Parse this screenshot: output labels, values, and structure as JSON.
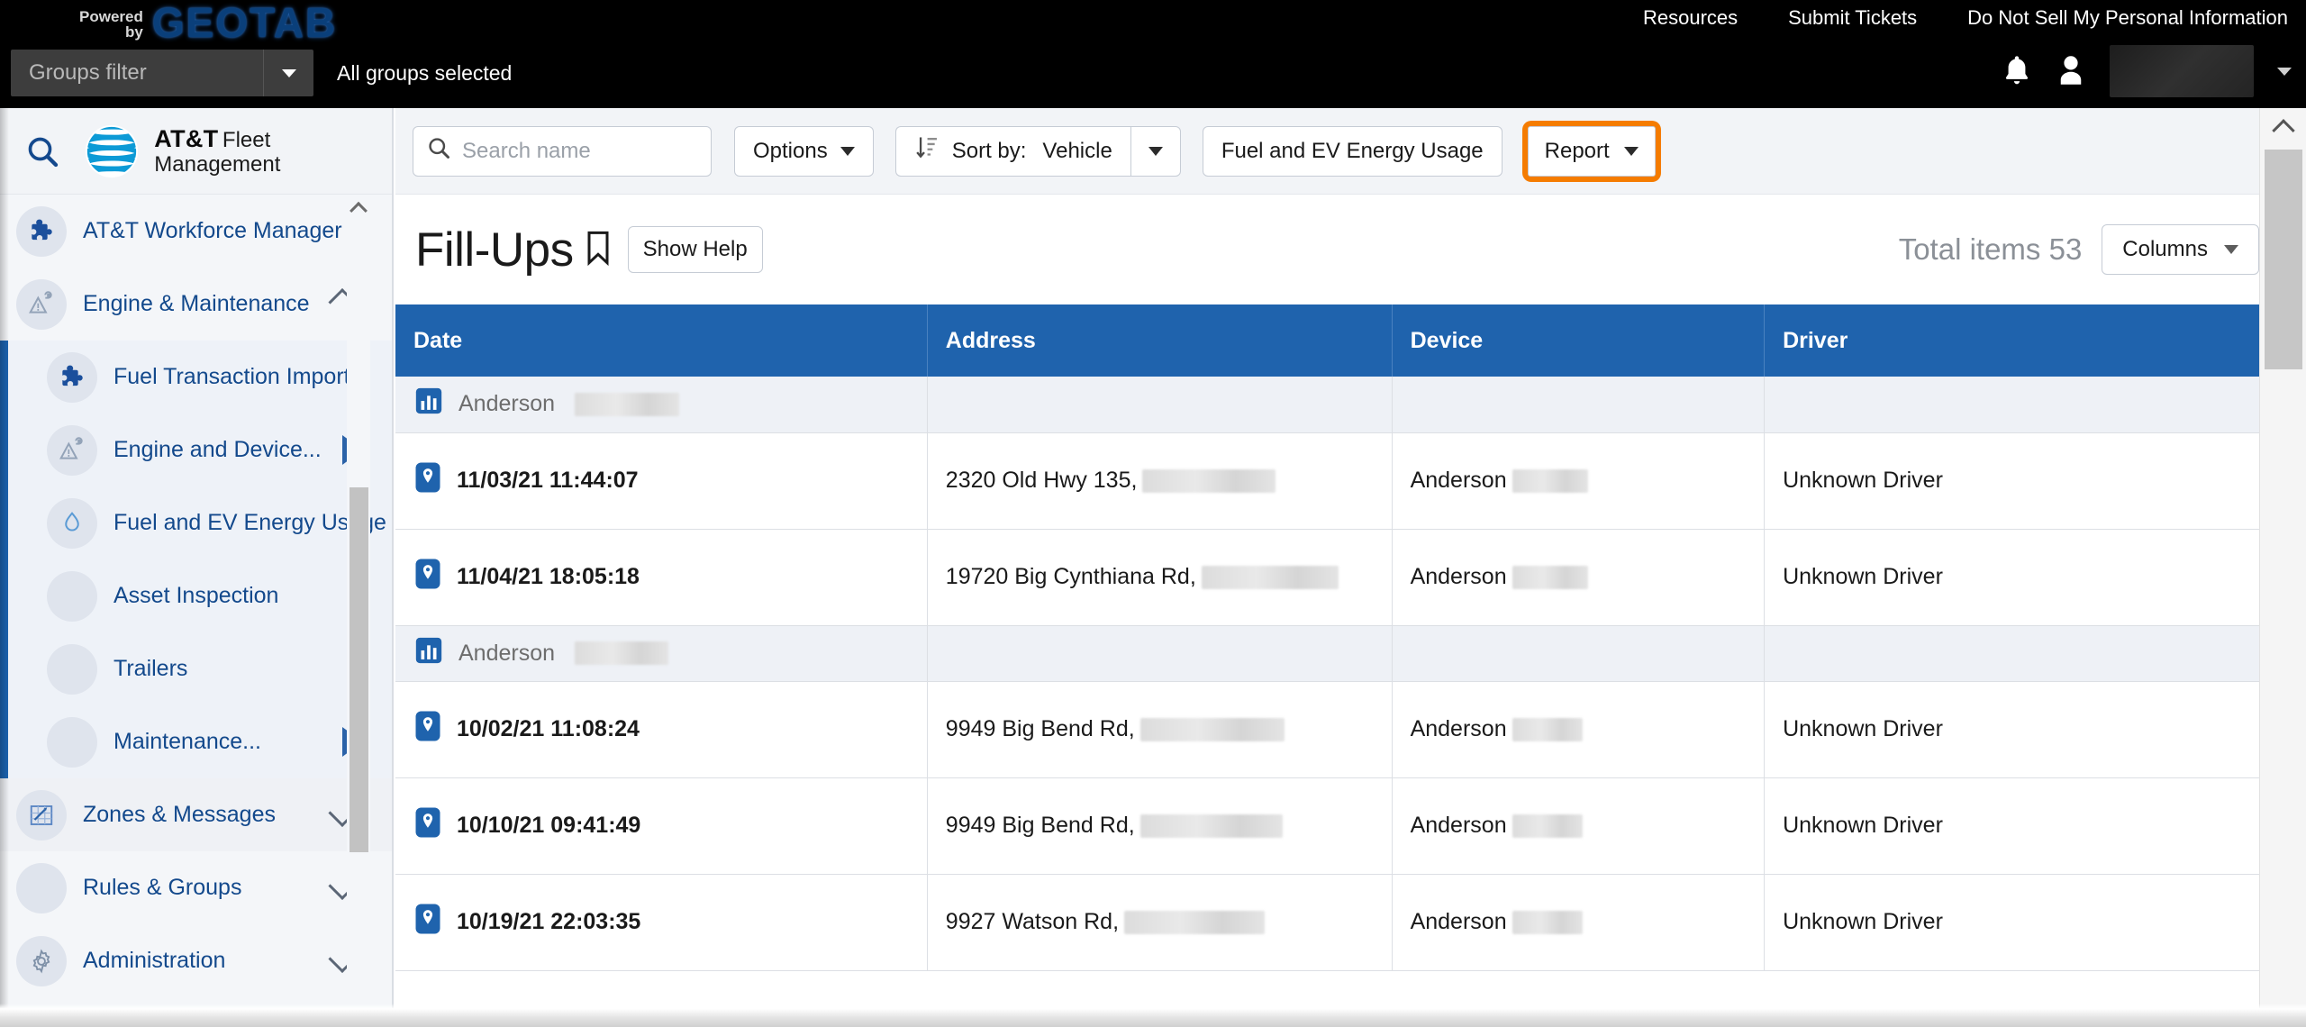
{
  "header": {
    "powered_line1": "Powered",
    "powered_line2": "by",
    "brand": "GEOTAB",
    "links": [
      "Resources",
      "Submit Tickets",
      "Do Not Sell My Personal Information"
    ],
    "groups_filter_placeholder": "Groups filter",
    "groups_selected_text": "All groups selected",
    "bell_icon": "bell-icon",
    "user_icon": "person-icon"
  },
  "sidebar": {
    "search_icon": "search-icon",
    "logo_line1": "AT&T",
    "logo_line2": "Fleet Management",
    "items": [
      {
        "label": "AT&T Workforce Manager",
        "icon": "puzzle-icon",
        "chevron": "",
        "level": 0
      },
      {
        "label": "Engine & Maintenance",
        "icon": "engine-warning-icon",
        "chevron": "up",
        "level": 0
      },
      {
        "label": "Fuel Transaction Import",
        "icon": "puzzle-icon",
        "chevron": "",
        "level": 1
      },
      {
        "label": "Engine and Device...",
        "icon": "engine-warning-icon",
        "chevron": "right",
        "level": 1
      },
      {
        "label": "Fuel and EV Energy Usage",
        "icon": "fuel-drop-icon",
        "chevron": "",
        "level": 1
      },
      {
        "label": "Asset Inspection",
        "icon": "blank-icon",
        "chevron": "",
        "level": 1
      },
      {
        "label": "Trailers",
        "icon": "blank-icon",
        "chevron": "",
        "level": 1
      },
      {
        "label": "Maintenance...",
        "icon": "blank-icon",
        "chevron": "right",
        "level": 1
      },
      {
        "label": "Zones & Messages",
        "icon": "zones-map-icon",
        "chevron": "down",
        "level": 0
      },
      {
        "label": "Rules & Groups",
        "icon": "blank-icon",
        "chevron": "down",
        "level": 0
      },
      {
        "label": "Administration",
        "icon": "gear-icon",
        "chevron": "down",
        "level": 0
      }
    ]
  },
  "toolbar": {
    "search_placeholder": "Search name",
    "search_value": "",
    "search_icon": "search-icon",
    "options_label": "Options",
    "sort_icon": "sort-descending-icon",
    "sort_label": "Sort by:",
    "sort_value": "Vehicle",
    "fuel_label": "Fuel and EV Energy Usage",
    "report_label": "Report",
    "highlight_color": "#f57c00"
  },
  "page": {
    "title": "Fill-Ups",
    "bookmark_icon": "bookmark-icon",
    "help_label": "Show Help",
    "total_items_label": "Total items 53",
    "columns_label": "Columns"
  },
  "table": {
    "columns": [
      "Date",
      "Address",
      "Device",
      "Driver"
    ],
    "header_color": "#1f63ad",
    "rows": [
      {
        "type": "group",
        "icon": "bar-chart-icon",
        "label": "Anderson",
        "redacted_width": 116
      },
      {
        "type": "data",
        "icon": "map-pin-icon",
        "date": "11/03/21 11:44:07",
        "address": "2320 Old Hwy 135,",
        "address_redacted_width": 148,
        "device": "Anderson",
        "device_redacted_width": 84,
        "driver": "Unknown Driver"
      },
      {
        "type": "data",
        "icon": "map-pin-icon",
        "date": "11/04/21 18:05:18",
        "address": "19720 Big Cynthiana Rd,",
        "address_redacted_width": 152,
        "device": "Anderson",
        "device_redacted_width": 84,
        "driver": "Unknown Driver"
      },
      {
        "type": "group",
        "icon": "bar-chart-icon",
        "label": "Anderson",
        "redacted_width": 104
      },
      {
        "type": "data",
        "icon": "map-pin-icon",
        "date": "10/02/21 11:08:24",
        "address": "9949 Big Bend Rd,",
        "address_redacted_width": 160,
        "device": "Anderson",
        "device_redacted_width": 78,
        "driver": "Unknown Driver"
      },
      {
        "type": "data",
        "icon": "map-pin-icon",
        "date": "10/10/21 09:41:49",
        "address": "9949 Big Bend Rd,",
        "address_redacted_width": 158,
        "device": "Anderson",
        "device_redacted_width": 78,
        "driver": "Unknown Driver"
      },
      {
        "type": "data",
        "icon": "map-pin-icon",
        "date": "10/19/21 22:03:35",
        "address": "9927 Watson Rd,",
        "address_redacted_width": 156,
        "device": "Anderson",
        "device_redacted_width": 78,
        "driver": "Unknown Driver"
      }
    ]
  }
}
